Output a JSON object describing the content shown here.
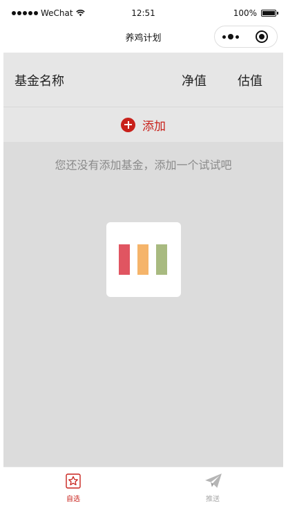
{
  "colors": {
    "accent": "#c8211b",
    "inactive": "#aaaaaa"
  },
  "status_bar": {
    "carrier": "WeChat",
    "time": "12:51",
    "battery": "100%"
  },
  "nav": {
    "title": "养鸡计划",
    "menu_icon": "more-dots-icon",
    "close_icon": "target-icon"
  },
  "table_header": {
    "name": "基金名称",
    "nav": "净值",
    "estimate": "估值"
  },
  "add": {
    "icon": "plus-circle-icon",
    "label": "添加"
  },
  "empty_message": "您还没有添加基金，添加一个试试吧",
  "loader": {
    "bars": [
      "#e05561",
      "#f5b46a",
      "#a8ba80"
    ]
  },
  "tabs": [
    {
      "label": "自选",
      "icon": "star-icon",
      "active": true
    },
    {
      "label": "推送",
      "icon": "paper-plane-icon",
      "active": false
    }
  ]
}
